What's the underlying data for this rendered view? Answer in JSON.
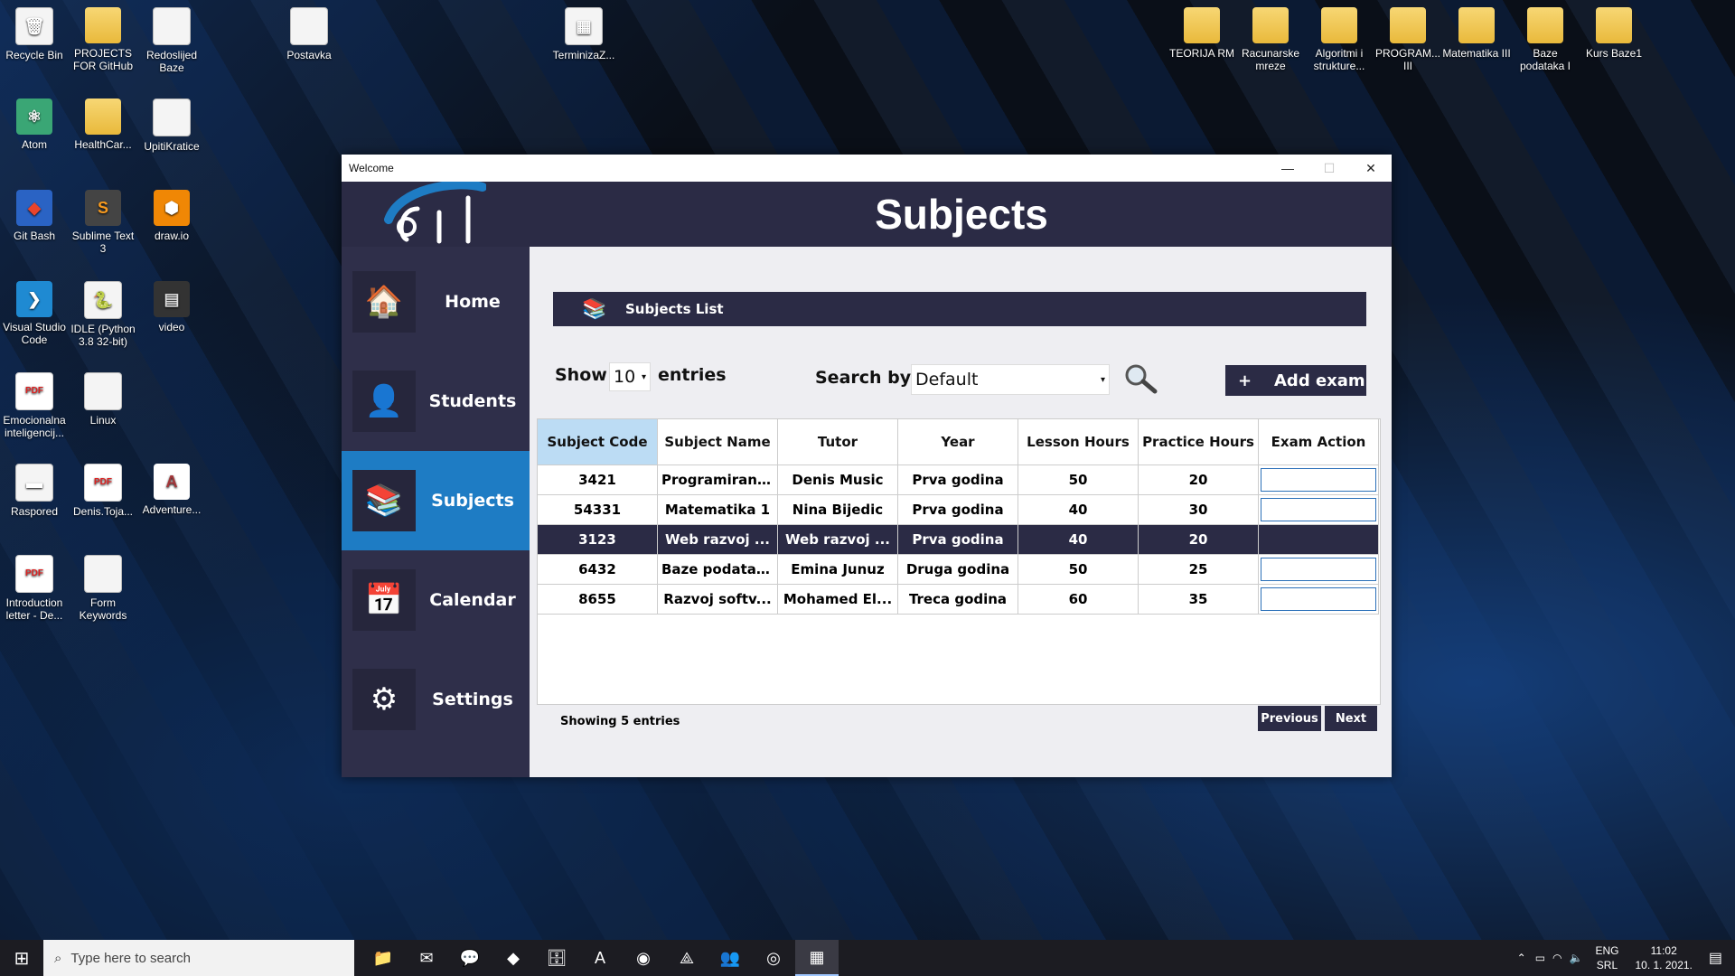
{
  "desktop": {
    "icons": [
      {
        "label": "Recycle Bin",
        "glyph": "🗑",
        "kind": "doc"
      },
      {
        "label": "PROJECTS FOR GitHub",
        "glyph": "",
        "kind": "folder"
      },
      {
        "label": "Redoslijed Baze",
        "glyph": "",
        "kind": "doc"
      },
      {
        "label": "Postavka",
        "glyph": "",
        "kind": "doc"
      },
      {
        "label": "TerminizaZ...",
        "glyph": "▦",
        "kind": "doc"
      },
      {
        "label": "TEORIJA RM",
        "glyph": "",
        "kind": "folder"
      },
      {
        "label": "Racunarske mreze",
        "glyph": "",
        "kind": "folder"
      },
      {
        "label": "Algoritmi i strukture...",
        "glyph": "",
        "kind": "folder"
      },
      {
        "label": "PROGRAM... III",
        "glyph": "",
        "kind": "folder"
      },
      {
        "label": "Matematika III",
        "glyph": "",
        "kind": "folder"
      },
      {
        "label": "Baze podataka I",
        "glyph": "",
        "kind": "folder"
      },
      {
        "label": "Kurs Baze1",
        "glyph": "",
        "kind": "folder"
      },
      {
        "label": "Atom",
        "glyph": "⚛",
        "kind": "atom"
      },
      {
        "label": "HealthCar...",
        "glyph": "",
        "kind": "folder"
      },
      {
        "label": "UpitiKratice",
        "glyph": "",
        "kind": "doc"
      },
      {
        "label": "Git Bash",
        "glyph": "◆",
        "kind": "git"
      },
      {
        "label": "Sublime Text 3",
        "glyph": "S",
        "kind": "sublime"
      },
      {
        "label": "draw.io",
        "glyph": "⬢",
        "kind": "drawio"
      },
      {
        "label": "Visual Studio Code",
        "glyph": "❯",
        "kind": "vscode"
      },
      {
        "label": "IDLE (Python 3.8 32-bit)",
        "glyph": "🐍",
        "kind": "doc"
      },
      {
        "label": "video",
        "glyph": "▤",
        "kind": "video"
      },
      {
        "label": "Emocionalna inteligencij...",
        "glyph": "PDF",
        "kind": "pdf"
      },
      {
        "label": "Linux",
        "glyph": "",
        "kind": "doc"
      },
      {
        "label": "Raspored",
        "glyph": "▬",
        "kind": "doc"
      },
      {
        "label": "Denis.Toja...",
        "glyph": "PDF",
        "kind": "pdf"
      },
      {
        "label": "Adventure...",
        "glyph": "A",
        "kind": "access"
      },
      {
        "label": "Introduction letter - De...",
        "glyph": "PDF",
        "kind": "pdf"
      },
      {
        "label": "Form Keywords",
        "glyph": "",
        "kind": "doc"
      }
    ]
  },
  "window": {
    "title": "Welcome",
    "minimize": "—",
    "maximize": "☐",
    "close": "✕"
  },
  "app": {
    "page_title": "Subjects",
    "nav": [
      {
        "label": "Home",
        "icon": "🏠",
        "active": false
      },
      {
        "label": "Students",
        "icon": "👤",
        "active": false
      },
      {
        "label": "Subjects",
        "icon": "📚",
        "active": true
      },
      {
        "label": "Calendar",
        "icon": "📅",
        "active": false
      },
      {
        "label": "Settings",
        "icon": "⚙",
        "active": false
      }
    ],
    "list_title": "Subjects List",
    "show_label": "Show",
    "entries_value": "10",
    "entries_label": "entries",
    "search_by_label": "Search by:",
    "search_by_value": "Default",
    "add_exam_plus": "+",
    "add_exam_label": "Add exam",
    "table": {
      "headers": [
        "Subject Code",
        "Subject Name",
        "Tutor",
        "Year",
        "Lesson Hours",
        "Practice Hours",
        "Exam Action"
      ],
      "rows": [
        [
          "3421",
          "Programiranj...",
          "Denis Music",
          "Prva godina",
          "50",
          "20"
        ],
        [
          "54331",
          "Matematika 1",
          "Nina Bijedic",
          "Prva godina",
          "40",
          "30"
        ],
        [
          "3123",
          "Web razvoj ...",
          "Web razvoj ...",
          "Prva godina",
          "40",
          "20"
        ],
        [
          "6432",
          "Baze podataka",
          "Emina Junuz",
          "Druga godina",
          "50",
          "25"
        ],
        [
          "8655",
          "Razvoj softv...",
          "Mohamed El...",
          "Treca godina",
          "60",
          "35"
        ]
      ],
      "selected_row": 2
    },
    "showing_text": "Showing 5 entries",
    "previous_label": "Previous",
    "next_label": "Next"
  },
  "taskbar": {
    "search_placeholder": "Type here to search",
    "apps": [
      "📁",
      "✉",
      "💬",
      "◆",
      "🗄",
      "A",
      "◉",
      "⟁",
      "👥",
      "◎",
      "▦"
    ],
    "lang_top": "ENG",
    "lang_bottom": "SRL",
    "time": "11:02",
    "date": "10. 1. 2021."
  }
}
